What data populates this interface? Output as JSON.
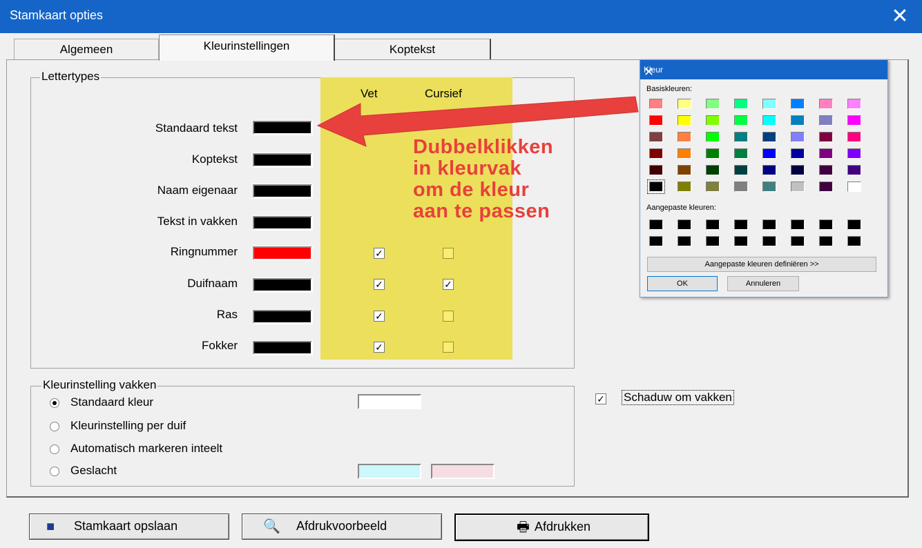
{
  "window": {
    "title": "Stamkaart opties",
    "close_glyph": "✕"
  },
  "tabs": [
    {
      "label": "Algemeen"
    },
    {
      "label": "Kleurinstellingen"
    },
    {
      "label": "Koptekst"
    }
  ],
  "lettertypes": {
    "group_label": "Lettertypes",
    "col_vet": "Vet",
    "col_cursief": "Cursief",
    "rows": [
      {
        "label": "Standaard tekst",
        "color": "#000000",
        "vet": null,
        "cursief": null
      },
      {
        "label": "Koptekst",
        "color": "#000000",
        "vet": null,
        "cursief": null
      },
      {
        "label": "Naam eigenaar",
        "color": "#000000",
        "vet": null,
        "cursief": null
      },
      {
        "label": "Tekst in vakken",
        "color": "#000000",
        "vet": null,
        "cursief": null
      },
      {
        "label": "Ringnummer",
        "color": "#ff0000",
        "vet": true,
        "cursief": false
      },
      {
        "label": "Duifnaam",
        "color": "#000000",
        "vet": true,
        "cursief": true
      },
      {
        "label": "Ras",
        "color": "#000000",
        "vet": true,
        "cursief": false
      },
      {
        "label": "Fokker",
        "color": "#000000",
        "vet": true,
        "cursief": false
      }
    ],
    "highlight_color": "#ecdf5b"
  },
  "annotation": {
    "lines": [
      "Dubbelklikken",
      "in kleurvak",
      "om de kleur",
      "aan te passen"
    ],
    "color": "#e8403c"
  },
  "kleur_vakken": {
    "group_label": "Kleurinstelling vakken",
    "options": [
      {
        "label": "Standaard kleur",
        "selected": true
      },
      {
        "label": "Kleurinstelling per duif",
        "selected": false
      },
      {
        "label": "Automatisch markeren inteelt",
        "selected": false
      },
      {
        "label": "Geslacht",
        "selected": false
      }
    ],
    "standaard_color": "#ffffff",
    "geslacht_colors": [
      "#ccf7fb",
      "#f5dde3"
    ]
  },
  "schaduw": {
    "label": "Schaduw om vakken",
    "checked": true
  },
  "buttons": {
    "opslaan": "Stamkaart opslaan",
    "voorbeeld": "Afdrukvoorbeeld",
    "afdrukken": "Afdrukken"
  },
  "kleur_dialog": {
    "title": "Kleur",
    "basis_label": "Basiskleuren:",
    "basis_colors": [
      [
        "#ff8080",
        "#ffff80",
        "#80ff80",
        "#00ff80",
        "#80ffff",
        "#0080ff",
        "#ff80c0",
        "#ff80ff"
      ],
      [
        "#ff0000",
        "#ffff00",
        "#80ff00",
        "#00ff40",
        "#00ffff",
        "#0080c0",
        "#8080c0",
        "#ff00ff"
      ],
      [
        "#804040",
        "#ff8040",
        "#00ff00",
        "#008080",
        "#004080",
        "#8080ff",
        "#800040",
        "#ff0080"
      ],
      [
        "#800000",
        "#ff8000",
        "#008000",
        "#008040",
        "#0000ff",
        "#0000a0",
        "#800080",
        "#8000ff"
      ],
      [
        "#400000",
        "#804000",
        "#004000",
        "#004040",
        "#000080",
        "#000040",
        "#400040",
        "#400080"
      ],
      [
        "#000000",
        "#808000",
        "#808040",
        "#808080",
        "#408080",
        "#c0c0c0",
        "#400040",
        "#ffffff"
      ]
    ],
    "aangepast_label": "Aangepaste kleuren:",
    "custom_colors": [
      [
        "#000000",
        "#000000",
        "#000000",
        "#000000",
        "#000000",
        "#000000",
        "#000000",
        "#000000"
      ],
      [
        "#000000",
        "#000000",
        "#000000",
        "#000000",
        "#000000",
        "#000000",
        "#000000",
        "#000000"
      ]
    ],
    "define_button": "Aangepaste kleuren definiëren >>",
    "ok_button": "OK",
    "cancel_button": "Annuleren"
  }
}
